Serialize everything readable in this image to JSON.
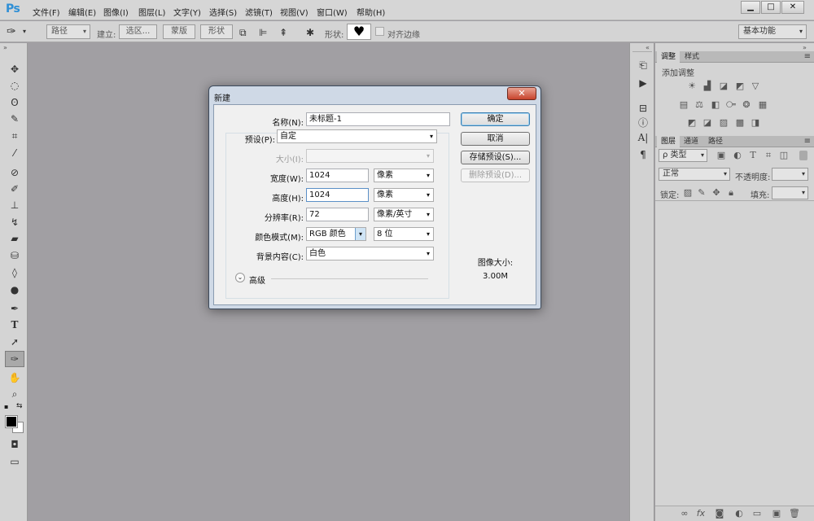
{
  "app": {
    "logo": "Ps"
  },
  "menu": [
    "文件(F)",
    "编辑(E)",
    "图像(I)",
    "图层(L)",
    "文字(Y)",
    "选择(S)",
    "滤镜(T)",
    "视图(V)",
    "窗口(W)",
    "帮助(H)"
  ],
  "window_controls": {
    "minimize": "▁",
    "maximize": "□",
    "close": "✕"
  },
  "options_bar": {
    "mode_select": "路径",
    "create_label": "建立:",
    "selection_btn": "选区...",
    "mask_btn": "蒙版",
    "shape_btn": "形状",
    "shape_label": "形状:",
    "align_edges_label": "对齐边缘",
    "workspace": "基本功能"
  },
  "icons": {
    "arrow": "▾",
    "collapse": "«",
    "expand": "»",
    "menu": "≡"
  },
  "adjustments_panel": {
    "tabs": [
      "调整",
      "样式"
    ],
    "title": "添加调整"
  },
  "layers_panel": {
    "tabs": [
      "图层",
      "通道",
      "路径"
    ],
    "filter_label": "ρ 类型",
    "blend_mode": "正常",
    "opacity_label": "不透明度:",
    "lock_label": "锁定:",
    "fill_label": "填充:",
    "footer_icons": [
      "∞",
      "fx",
      "◙",
      "◐",
      "▭",
      "▣",
      "🗑"
    ]
  },
  "dialog": {
    "title": "新建",
    "close": "✕",
    "name_label": "名称(N):",
    "name_value": "未标题-1",
    "preset_label": "预设(P):",
    "preset_value": "自定",
    "size_label": "大小(I):",
    "width_label": "宽度(W):",
    "width_value": "1024",
    "width_unit": "像素",
    "height_label": "高度(H):",
    "height_value": "1024",
    "height_unit": "像素",
    "resolution_label": "分辨率(R):",
    "resolution_value": "72",
    "resolution_unit": "像素/英寸",
    "color_mode_label": "颜色模式(M):",
    "color_mode_value": "RGB 颜色",
    "bit_depth_value": "8 位",
    "background_label": "背景内容(C):",
    "background_value": "白色",
    "advanced_label": "高级",
    "ok_btn": "确定",
    "cancel_btn": "取消",
    "save_preset_btn": "存储预设(S)...",
    "delete_preset_btn": "删除预设(D)...",
    "image_size_label": "图像大小:",
    "image_size_value": "3.00M"
  }
}
